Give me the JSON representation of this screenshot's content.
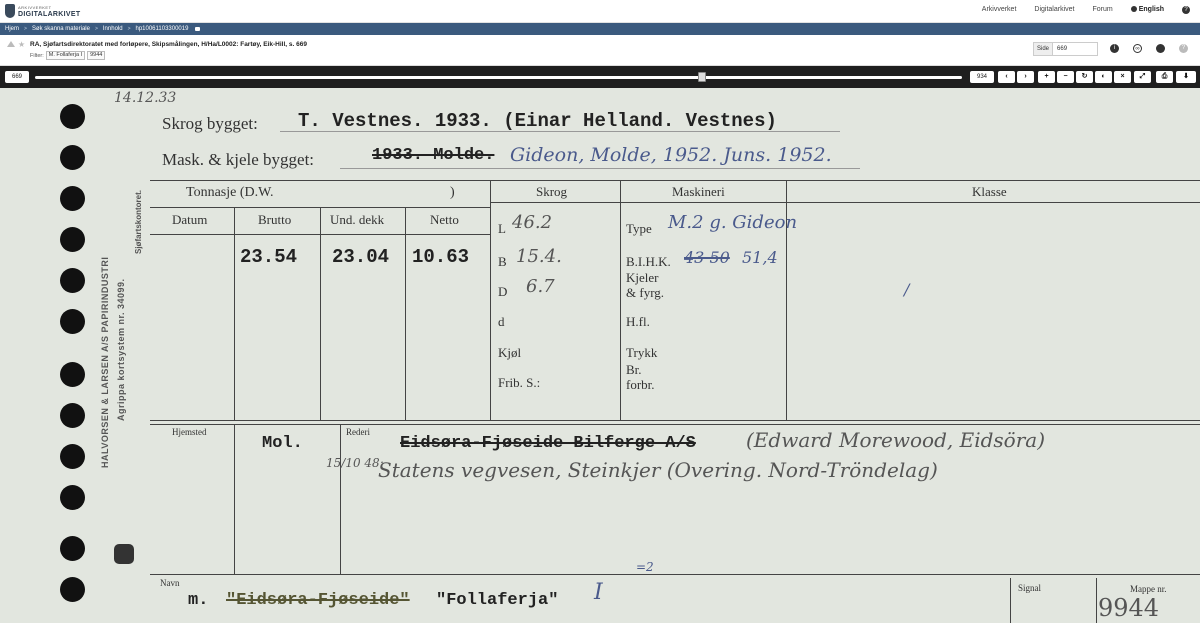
{
  "header": {
    "logo_small": "ARKIVVERKET",
    "logo_big": "DIGITALARKIVET",
    "nav": [
      "Arkivverket",
      "Digitalarkivet",
      "Forum"
    ],
    "language": "English"
  },
  "breadcrumb": [
    "Hjem",
    "Søk skanna materiale",
    "Innhold",
    "hp10061103300019"
  ],
  "info": {
    "title": "RA, Sjøfartsdirektoratet med forløpere, Skipsmålingen, H/Ha/L0002: Fartøy, Eik-Hill, s. 669",
    "filter_label": "Filter:",
    "filter_chip": "M. Follaferja I",
    "filter_number": "9944",
    "side_label": "Side",
    "side_value": "669"
  },
  "viewer": {
    "current_page": "669",
    "total_pages": "934",
    "slider_position": 0.72
  },
  "card": {
    "date_stamp": "14.12.33",
    "skrog_label": "Skrog bygget:",
    "skrog_value": "T. Vestnes. 1933. (Einar Helland. Vestnes)",
    "mask_label": "Mask. & kjele bygget:",
    "mask_struck": "1933. Molde.",
    "mask_hand": "Gideon, Molde, 1952. Juns. 1952.",
    "tonnasje_label": "Tonnasje (D.W.",
    "tonnasje_close": ")",
    "col_datum": "Datum",
    "col_brutto": "Brutto",
    "col_und": "Und. dekk",
    "col_netto": "Netto",
    "brutto": "23.54",
    "und": "23.04",
    "netto": "10.63",
    "col_skrog": "Skrog",
    "col_maskineri": "Maskineri",
    "col_klasse": "Klasse",
    "skrog_rows": [
      "L",
      "B",
      "D",
      "d",
      "Kjøl",
      "Frib. S.:"
    ],
    "skrog_vals": [
      "46.2",
      "15.4.",
      "6.7"
    ],
    "mask_rows": [
      "Type",
      "B.I.H.K.",
      "Kjeler",
      "& fyrg.",
      "H.fl.",
      "Trykk",
      "Br.",
      "forbr."
    ],
    "mask_type": "M.2 g. Gideon",
    "mask_bihk_struck": "43 50",
    "mask_bihk": "51,4",
    "klasse_mark": "/",
    "hjemsted_label": "Hjemsted",
    "hjemsted_value": "Mol.",
    "rederi_label": "Rederi",
    "rederi_typed": "Eidsøra-Fjøseide Bilferge A/S",
    "rederi_hand1": "(Edward Morewood, Eidsöra)",
    "rederi_date": "15/10 48:",
    "rederi_hand2": "Statens vegvesen, Steinkjer (Overing. Nord-Tröndelag)",
    "navn_label": "Navn",
    "navn_prefix": "m.",
    "navn_struck": "\"Eidsøra-Fjøseide\"",
    "navn_value": "\"Follaferja\"",
    "navn_roman": "I",
    "navn_sup": "=2",
    "signal_label": "Signal",
    "mappe_label": "Mappe nr.",
    "mappe_value": "9944",
    "side_print1": "HALVORSEN & LARSEN A/S PAPIRINDUSTRI",
    "side_print2": "Agrippa kortsystem nr. 34099.",
    "side_print3": "Sjøfartskontoret."
  }
}
